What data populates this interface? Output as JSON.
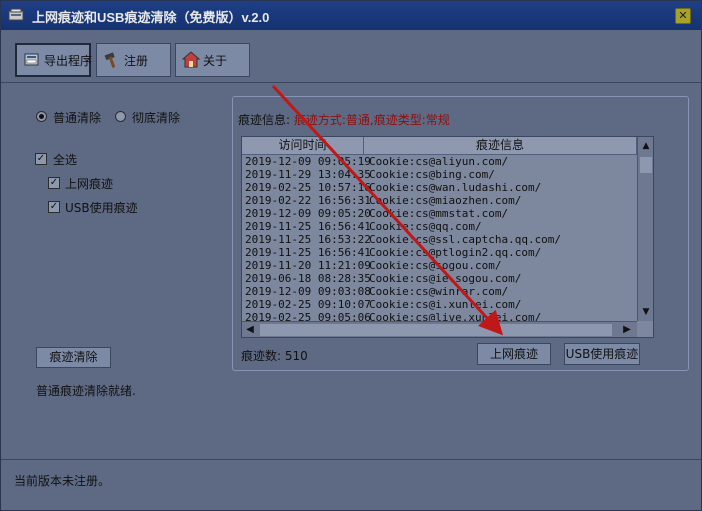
{
  "window": {
    "title": "上网痕迹和USB痕迹清除（免费版）v.2.0"
  },
  "toolbar": {
    "export_label": "导出程序",
    "register_label": "注册",
    "about_label": "关于"
  },
  "options": {
    "normal_clean": "普通清除",
    "deep_clean": "彻底清除",
    "select_all": "全选",
    "internet_trace": "上网痕迹",
    "usb_trace": "USB使用痕迹"
  },
  "clean_button": "痕迹清除",
  "status_message": "普通痕迹清除就绪.",
  "trace_info": {
    "title": "痕迹信息:",
    "detail": "痕迹方式:普通,痕迹类型:常规",
    "col_time": "访问时间",
    "col_info": "痕迹信息",
    "rows": [
      [
        "2019-12-09 09:05:19",
        "Cookie:cs@aliyun.com/"
      ],
      [
        "2019-11-29 13:04:35",
        "Cookie:cs@bing.com/"
      ],
      [
        "2019-02-25 10:57:16",
        "Cookie:cs@wan.ludashi.com/"
      ],
      [
        "2019-02-22 16:56:31",
        "Cookie:cs@miaozhen.com/"
      ],
      [
        "2019-12-09 09:05:20",
        "Cookie:cs@mmstat.com/"
      ],
      [
        "2019-11-25 16:56:41",
        "Cookie:cs@qq.com/"
      ],
      [
        "2019-11-25 16:53:22",
        "Cookie:cs@ssl.captcha.qq.com/"
      ],
      [
        "2019-11-25 16:56:41",
        "Cookie:cs@ptlogin2.qq.com/"
      ],
      [
        "2019-11-20 11:21:09",
        "Cookie:cs@sogou.com/"
      ],
      [
        "2019-06-18 08:28:35",
        "Cookie:cs@ie.sogou.com/"
      ],
      [
        "2019-12-09 09:03:08",
        "Cookie:cs@winrar.com/"
      ],
      [
        "2019-02-25 09:10:07",
        "Cookie:cs@i.xunlei.com/"
      ],
      [
        "2019-02-25 09:05:06",
        "Cookie:cs@live.xunlei.com/"
      ]
    ],
    "count_label": "痕迹数: 510",
    "btn_internet": "上网痕迹",
    "btn_usb": "USB使用痕迹"
  },
  "footer": {
    "text": "当前版本未注册。"
  }
}
